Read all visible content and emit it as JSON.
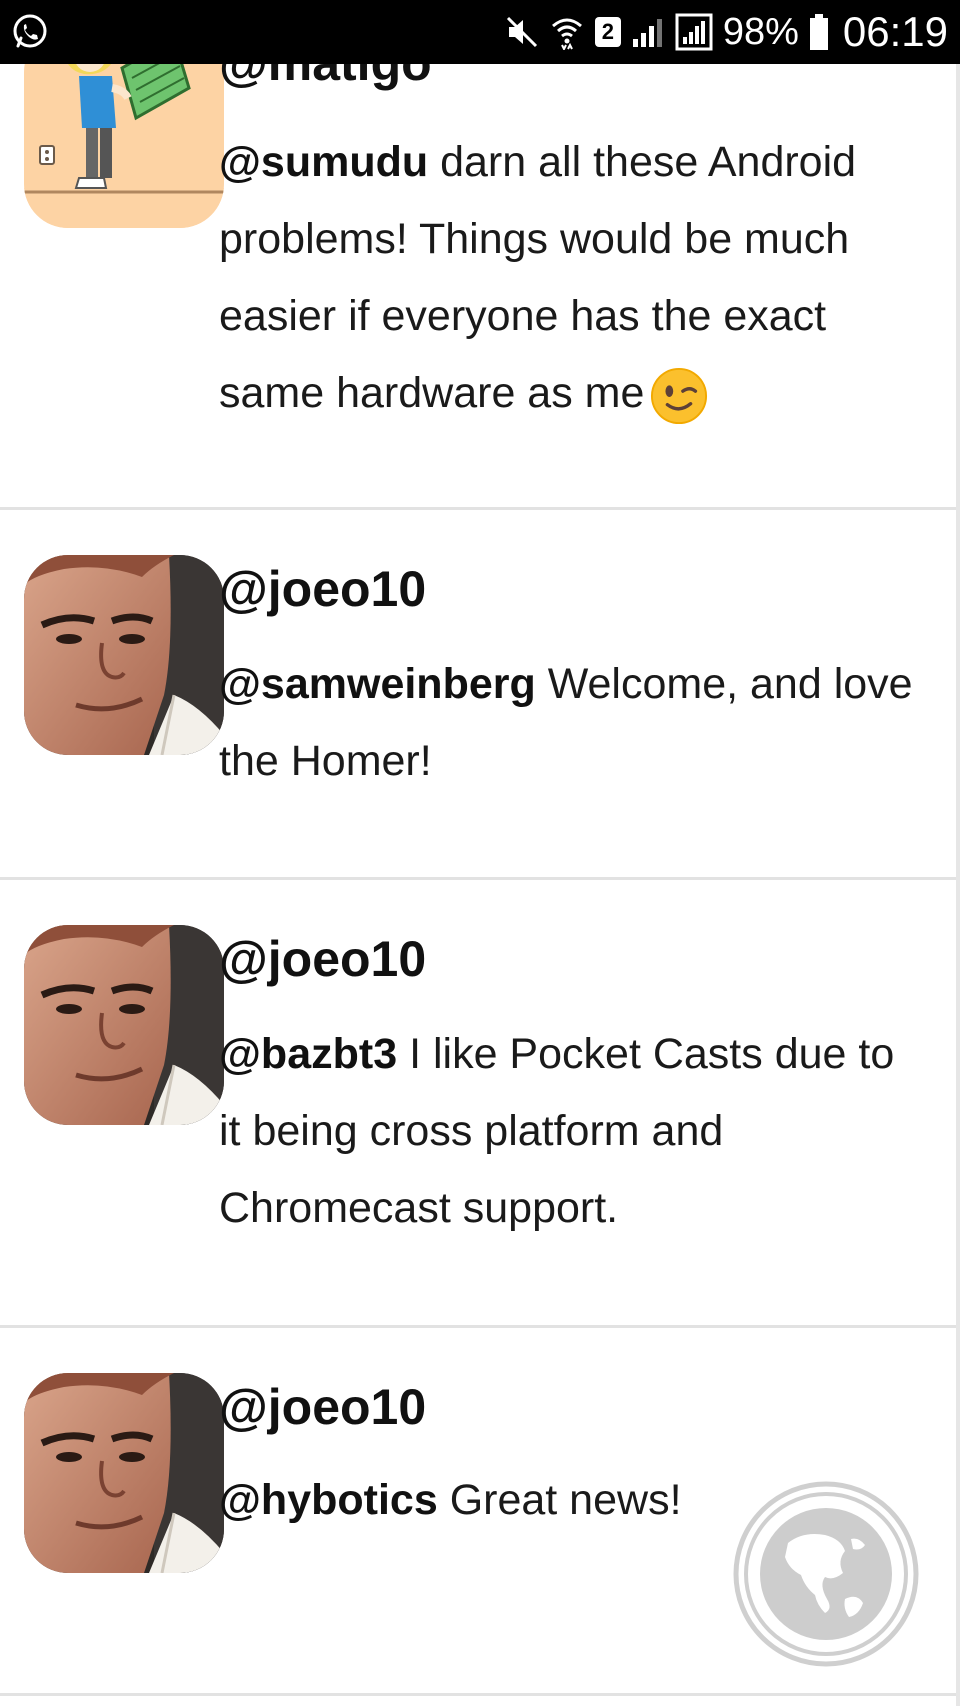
{
  "status_bar": {
    "left_icon": "whatsapp-icon",
    "icons": [
      "mute-icon",
      "wifi-icon",
      "sim-2-badge",
      "signal-icon",
      "signal-icon"
    ],
    "sim_label": "2",
    "battery_percent": "98%",
    "time": "06:19"
  },
  "tweets": [
    {
      "handle": "@matigo",
      "mention": "@sumudu",
      "text": " darn all these Android problems! Things would be much easier if everyone has the exact same hardware as me",
      "emoji": "winking-face-emoji",
      "avatar": "cartoon-avatar"
    },
    {
      "handle": "@joeo10",
      "mention": "@samweinberg",
      "text": " Welcome, and love the Homer!",
      "avatar": "photo-avatar"
    },
    {
      "handle": "@joeo10",
      "mention": "@bazbt3",
      "text": " I like Pocket Casts due to it being cross platform and Chromecast support.",
      "avatar": "photo-avatar"
    },
    {
      "handle": "@joeo10",
      "mention": "@hybotics",
      "text": " Great news!",
      "avatar": "photo-avatar"
    }
  ],
  "fab": {
    "icon": "globe-icon"
  },
  "colors": {
    "status_bar_bg": "#000000",
    "divider": "#e2e2e2",
    "fab_ring": "#cccccc"
  }
}
